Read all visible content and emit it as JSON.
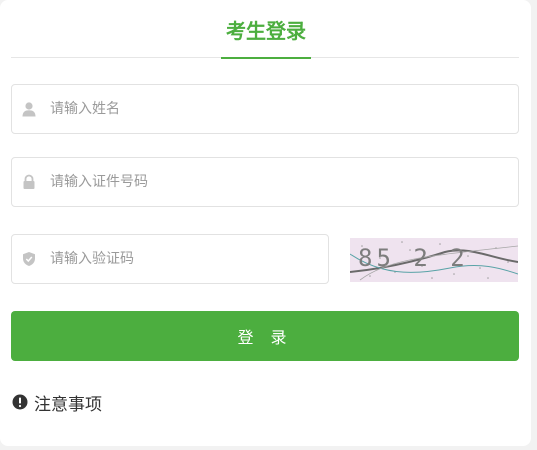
{
  "login": {
    "tab_label": "考生登录",
    "name_placeholder": "请输入姓名",
    "id_placeholder": "请输入证件号码",
    "captcha_placeholder": "请输入验证码",
    "captcha_code": "85 2 2",
    "submit_label": "登 录",
    "notice_label": "注意事项"
  },
  "colors": {
    "accent": "#4cae3f",
    "icon_gray": "#c4c4c4",
    "placeholder": "#9a9a9a"
  },
  "icons": {
    "name": "user-icon",
    "id": "lock-icon",
    "captcha": "shield-icon",
    "notice": "exclamation-circle-icon"
  }
}
